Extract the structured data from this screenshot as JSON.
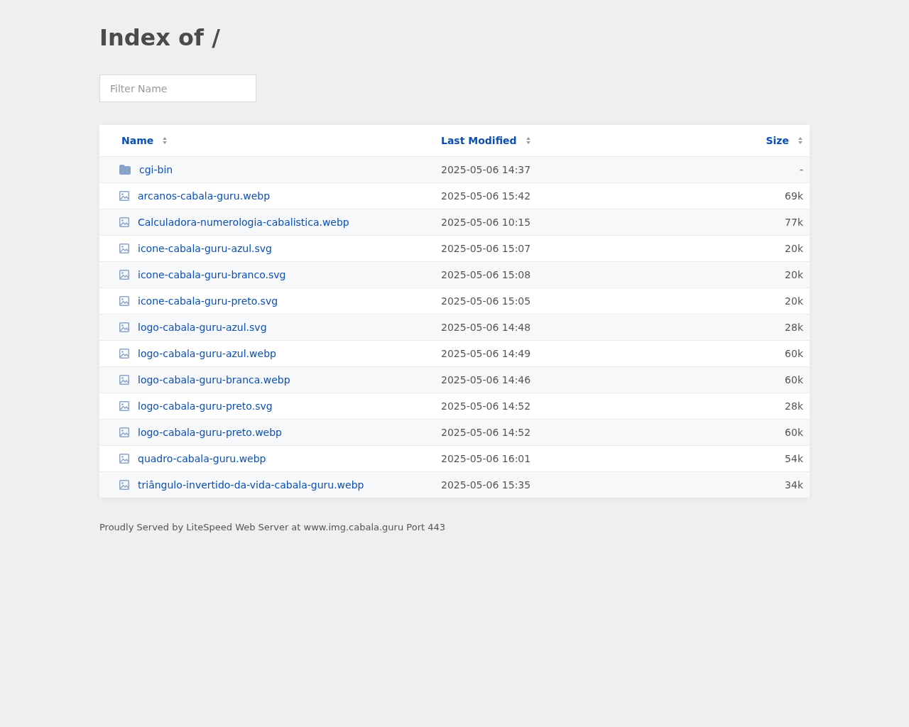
{
  "title": "Index of /",
  "filter": {
    "placeholder": "Filter Name"
  },
  "columns": [
    {
      "label": "Name"
    },
    {
      "label": "Last Modified"
    },
    {
      "label": "Size"
    }
  ],
  "rows": [
    {
      "kind": "folder",
      "name": "cgi-bin",
      "modified": "2025-05-06 14:37",
      "size": "-"
    },
    {
      "kind": "image",
      "name": "arcanos-cabala-guru.webp",
      "modified": "2025-05-06 15:42",
      "size": "69k"
    },
    {
      "kind": "image",
      "name": "Calculadora-numerologia-cabalistica.webp",
      "modified": "2025-05-06 10:15",
      "size": "77k"
    },
    {
      "kind": "image",
      "name": "icone-cabala-guru-azul.svg",
      "modified": "2025-05-06 15:07",
      "size": "20k"
    },
    {
      "kind": "image",
      "name": "icone-cabala-guru-branco.svg",
      "modified": "2025-05-06 15:08",
      "size": "20k"
    },
    {
      "kind": "image",
      "name": "icone-cabala-guru-preto.svg",
      "modified": "2025-05-06 15:05",
      "size": "20k"
    },
    {
      "kind": "image",
      "name": "logo-cabala-guru-azul.svg",
      "modified": "2025-05-06 14:48",
      "size": "28k"
    },
    {
      "kind": "image",
      "name": "logo-cabala-guru-azul.webp",
      "modified": "2025-05-06 14:49",
      "size": "60k"
    },
    {
      "kind": "image",
      "name": "logo-cabala-guru-branca.webp",
      "modified": "2025-05-06 14:46",
      "size": "60k"
    },
    {
      "kind": "image",
      "name": "logo-cabala-guru-preto.svg",
      "modified": "2025-05-06 14:52",
      "size": "28k"
    },
    {
      "kind": "image",
      "name": "logo-cabala-guru-preto.webp",
      "modified": "2025-05-06 14:52",
      "size": "60k"
    },
    {
      "kind": "image",
      "name": "quadro-cabala-guru.webp",
      "modified": "2025-05-06 16:01",
      "size": "54k"
    },
    {
      "kind": "image",
      "name": "triângulo-invertido-da-vida-cabala-guru.webp",
      "modified": "2025-05-06 15:35",
      "size": "34k"
    }
  ],
  "footer": "Proudly Served by LiteSpeed Web Server at www.img.cabala.guru Port 443"
}
